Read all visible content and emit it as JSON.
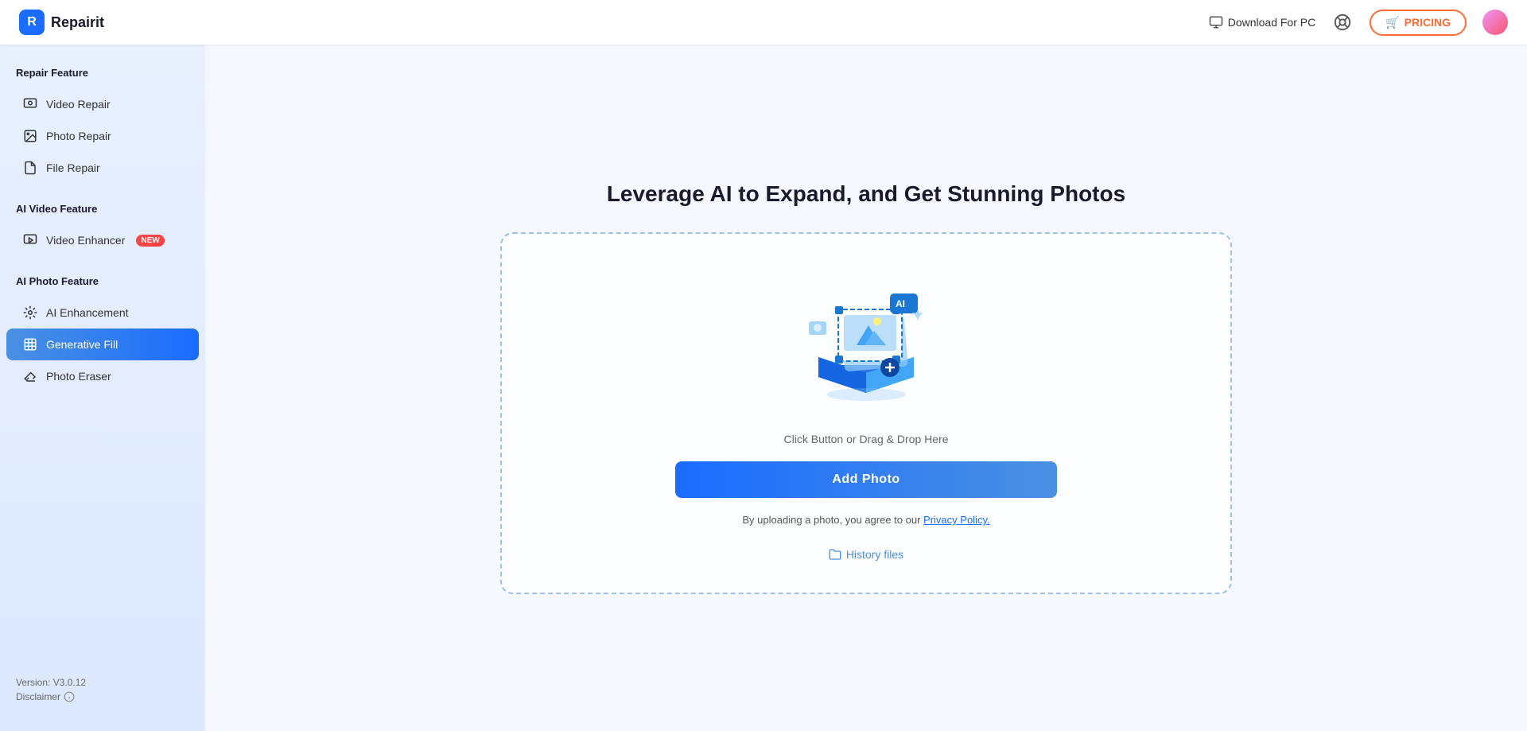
{
  "header": {
    "logo_text": "Repairit",
    "download_label": "Download For PC",
    "pricing_label": "PRICING",
    "pricing_icon": "🛒"
  },
  "sidebar": {
    "section1_title": "Repair Feature",
    "items_repair": [
      {
        "id": "video-repair",
        "label": "Video Repair",
        "icon": "▶",
        "active": false
      },
      {
        "id": "photo-repair",
        "label": "Photo Repair",
        "icon": "🖼",
        "active": false
      },
      {
        "id": "file-repair",
        "label": "File Repair",
        "icon": "📄",
        "active": false
      }
    ],
    "section2_title": "AI Video Feature",
    "items_ai_video": [
      {
        "id": "video-enhancer",
        "label": "Video Enhancer",
        "icon": "✨",
        "active": false,
        "badge": "NEW"
      }
    ],
    "section3_title": "AI Photo Feature",
    "items_ai_photo": [
      {
        "id": "ai-enhancement",
        "label": "AI Enhancement",
        "icon": "🤖",
        "active": false
      },
      {
        "id": "generative-fill",
        "label": "Generative Fill",
        "icon": "◈",
        "active": true
      },
      {
        "id": "photo-eraser",
        "label": "Photo Eraser",
        "icon": "◇",
        "active": false
      }
    ],
    "version": "Version: V3.0.12",
    "disclaimer": "Disclaimer"
  },
  "main": {
    "page_title": "Leverage AI to Expand, and Get Stunning Photos",
    "upload_prompt": "Click Button or Drag & Drop Here",
    "add_photo_label": "Add Photo",
    "privacy_text": "By uploading a photo, you agree to our ",
    "privacy_link": "Privacy Policy.",
    "history_label": "History files"
  }
}
